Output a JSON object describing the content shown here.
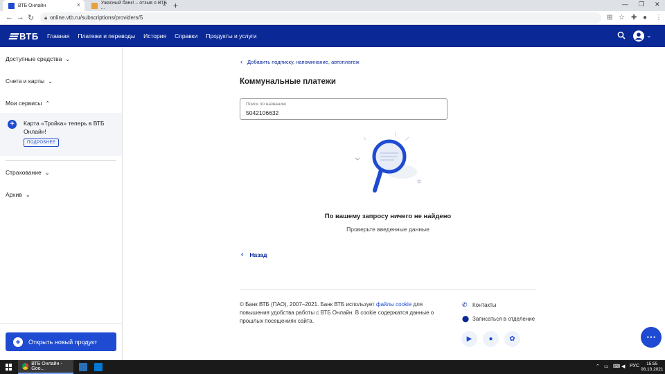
{
  "browser": {
    "tabs": [
      {
        "title": "ВТБ Онлайн",
        "active": true
      },
      {
        "title": "Ужасный банк! – отзыв о ВТБ ...",
        "active": false
      }
    ],
    "url": "online.vtb.ru/subscriptions/providers/5"
  },
  "header": {
    "logo": "ВТБ",
    "nav": [
      "Главная",
      "Платежи и переводы",
      "История",
      "Справки",
      "Продукты и услуги"
    ]
  },
  "sidebar": {
    "items": [
      {
        "label": "Доступные средства"
      },
      {
        "label": "Счета и карты"
      },
      {
        "label": "Мои сервисы"
      },
      {
        "label": "Страхование"
      },
      {
        "label": "Архив"
      }
    ],
    "promo": {
      "text": "Карта «Тройка» теперь в ВТБ Онлайн!",
      "button": "ПОДРОБНЕЕ"
    },
    "open_product": "Открыть новый продукт"
  },
  "main": {
    "back_link": "Добавить подписку, напоминание, автоплатеж",
    "title": "Коммунальные платежи",
    "search": {
      "placeholder": "Поиск по названию",
      "value": "5042106632"
    },
    "no_result": "По вашему запросу ничего не найдено",
    "hint": "Проверьте введенные данные",
    "back_button": "Назад"
  },
  "footer": {
    "copyright_before": "© Банк ВТБ (ПАО), 2007–2021. Банк ВТБ использует ",
    "copyright_link": "файлы cookie",
    "copyright_after": " для повышения удобства работы с ВТБ Онлайн. В cookie содержатся данные о прошлых посещениях сайта.",
    "contacts": "Контакты",
    "branch": "Записаться в отделение"
  },
  "taskbar": {
    "app": "ВТБ Онлайн - Goo...",
    "lang": "РУС",
    "time": "15:55",
    "date": "08.10.2021"
  },
  "colors": {
    "brand_dark": "#0a2896",
    "brand_accent": "#1e4bd2"
  }
}
